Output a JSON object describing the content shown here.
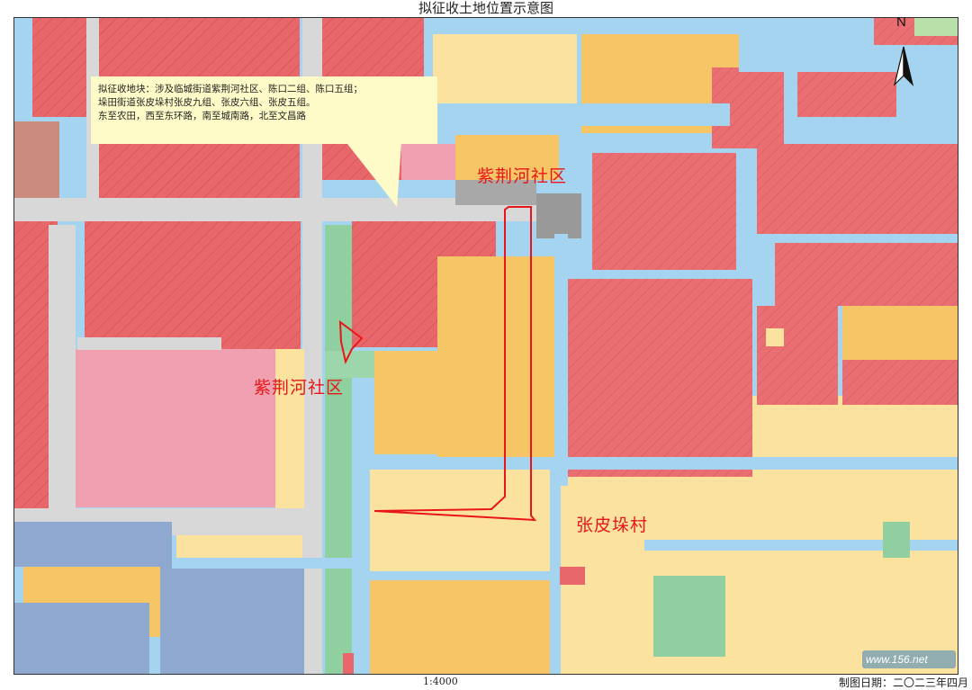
{
  "map": {
    "title": "拟征收土地位置示意图",
    "callout_lines": [
      "拟征收地块：涉及临城街道紫荆河社区、陈口二组、陈口五组；",
      "垛田街道张皮垛村张皮九组、张皮六组、张皮五组。",
      "东至农田，西至东环路，南至城南路，北至文昌路"
    ],
    "places": [
      {
        "name": "紫荆河社区"
      },
      {
        "name": "紫荆河社区"
      },
      {
        "name": "张皮垛村"
      }
    ],
    "north_label": "N",
    "scale": "1:4000",
    "date": "制图日期：二〇二三年四月",
    "watermark": "www.156.net",
    "colors": {
      "water": "#a4d4ef",
      "residential": "#e8676a",
      "road": "#d8d8d8",
      "farmland": "#fbe29e",
      "orchard": "#f6c566",
      "pink": "#f0a0b0",
      "green": "#8fcfa0",
      "blue_gray": "#8ea8cf",
      "boundary": "#e8161a",
      "callout": "#fffbc8"
    }
  }
}
